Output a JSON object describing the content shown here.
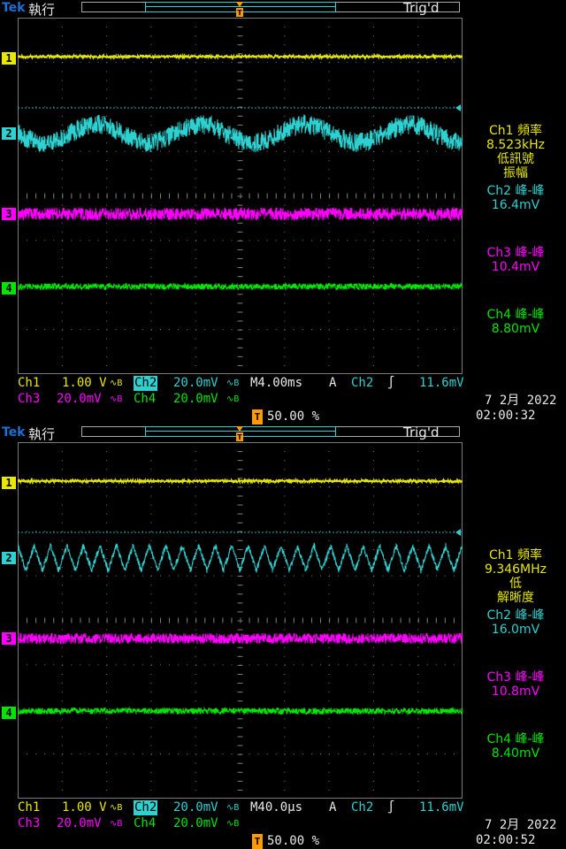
{
  "screens": [
    {
      "brand": "Tek",
      "status": "執行",
      "trigger_state": "Trig'd",
      "ch1_marker": "1",
      "ch2_marker": "2",
      "ch3_marker": "3",
      "ch4_marker": "4",
      "measurements": {
        "ch1_label": "Ch1 頻率",
        "ch1_value": "8.523kHz",
        "ch1_note1": "低訊號",
        "ch1_note2": "振幅",
        "ch2_label": "Ch2 峰-峰",
        "ch2_value": "16.4mV",
        "ch3_label": "Ch3 峰-峰",
        "ch3_value": "10.4mV",
        "ch4_label": "Ch4 峰-峰",
        "ch4_value": "8.80mV"
      },
      "bottom": {
        "ch1": "Ch1",
        "ch1_scale": "1.00 V",
        "ch2": "Ch2",
        "ch2_scale": "20.0mV",
        "ch3": "Ch3",
        "ch3_scale": "20.0mV",
        "ch4": "Ch4",
        "ch4_scale": "20.0mV",
        "bw_symbol": "∿B",
        "timebase": "M4.00ms",
        "mode": "A",
        "trig_source": "Ch2",
        "trig_slope": "∫",
        "trig_level": "11.6mV",
        "trig_pos_marker": "T",
        "trig_position": "50.00 %",
        "date": "7 2月  2022",
        "time": "02:00:32"
      },
      "waveforms": {
        "ch2_period_divs": 2.35,
        "ch2_amplitude_divs": 0.2,
        "ch2_noise_divs": 0.22,
        "ch3_noise_divs": 0.14,
        "ch4_noise_divs": 0.07,
        "ch1_noise_divs": 0.025
      }
    },
    {
      "brand": "Tek",
      "status": "執行",
      "trigger_state": "Trig'd",
      "ch1_marker": "1",
      "ch2_marker": "2",
      "ch3_marker": "3",
      "ch4_marker": "4",
      "measurements": {
        "ch1_label": "Ch1 頻率",
        "ch1_value": "9.346MHz",
        "ch1_note1": "低",
        "ch1_note2": "解晰度",
        "ch2_label": "Ch2 峰-峰",
        "ch2_value": "16.0mV",
        "ch3_label": "Ch3 峰-峰",
        "ch3_value": "10.8mV",
        "ch4_label": "Ch4 峰-峰",
        "ch4_value": "8.40mV"
      },
      "bottom": {
        "ch1": "Ch1",
        "ch1_scale": "1.00 V",
        "ch2": "Ch2",
        "ch2_scale": "20.0mV",
        "ch3": "Ch3",
        "ch3_scale": "20.0mV",
        "ch4": "Ch4",
        "ch4_scale": "20.0mV",
        "bw_symbol": "∿B",
        "timebase": "M40.0μs",
        "mode": "A",
        "trig_source": "Ch2",
        "trig_slope": "∫",
        "trig_level": "11.6mV",
        "trig_pos_marker": "T",
        "trig_position": "50.00 %",
        "date": "7 2月  2022",
        "time": "02:00:52"
      },
      "waveforms": {
        "ch2_period_divs": 0.37,
        "ch2_amplitude_divs": 0.28,
        "ch2_noise_divs": 0.07,
        "ch3_noise_divs": 0.12,
        "ch4_noise_divs": 0.07,
        "ch1_noise_divs": 0.025
      }
    }
  ],
  "colors": {
    "ch1": "#e7e700",
    "ch2": "#2fd0d0",
    "ch3": "#ff00ff",
    "ch4": "#00e600",
    "trigger": "#ff9a00",
    "grid": "#7a7a7a"
  }
}
